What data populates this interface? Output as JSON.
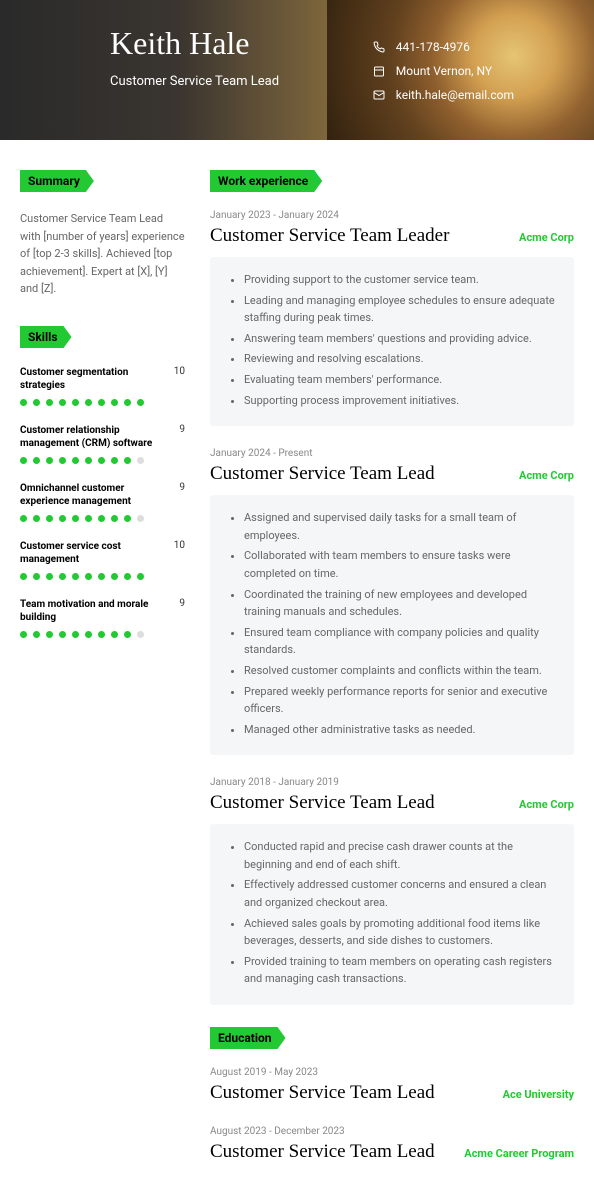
{
  "header": {
    "name": "Keith Hale",
    "title": "Customer Service Team Lead",
    "phone": "441-178-4976",
    "location": "Mount Vernon, NY",
    "email": "keith.hale@email.com"
  },
  "sections": {
    "summary": "Summary",
    "skills": "Skills",
    "work": "Work experience",
    "education": "Education"
  },
  "summary_text": "Customer Service Team Lead with [number of years] experience of [top 2-3 skills]. Achieved [top achievement]. Expert at [X], [Y] and [Z].",
  "skills": [
    {
      "name": "Customer segmentation strategies",
      "level": 10
    },
    {
      "name": "Customer relationship management (CRM) software",
      "level": 9
    },
    {
      "name": "Omnichannel customer experience management",
      "level": 9
    },
    {
      "name": "Customer service cost management",
      "level": 10
    },
    {
      "name": "Team motivation and morale building",
      "level": 9
    }
  ],
  "jobs": [
    {
      "dates": "January 2023 - January 2024",
      "title": "Customer Service Team Leader",
      "company": "Acme Corp",
      "bullets": [
        "Providing support to the customer service team.",
        "Leading and managing employee schedules to ensure adequate staffing during peak times.",
        "Answering team members' questions and providing advice.",
        "Reviewing and resolving escalations.",
        "Evaluating team members' performance.",
        "Supporting process improvement initiatives."
      ]
    },
    {
      "dates": "January 2024 - Present",
      "title": "Customer Service Team Lead",
      "company": "Acme Corp",
      "bullets": [
        "Assigned and supervised daily tasks for a small team of employees.",
        "Collaborated with team members to ensure tasks were completed on time.",
        "Coordinated the training of new employees and developed training manuals and schedules.",
        "Ensured team compliance with company policies and quality standards.",
        "Resolved customer complaints and conflicts within the team.",
        "Prepared weekly performance reports for senior and executive officers.",
        "Managed other administrative tasks as needed."
      ]
    },
    {
      "dates": "January 2018 - January 2019",
      "title": "Customer Service Team Lead",
      "company": "Acme Corp",
      "bullets": [
        "Conducted rapid and precise cash drawer counts at the beginning and end of each shift.",
        "Effectively addressed customer concerns and ensured a clean and organized checkout area.",
        "Achieved sales goals by promoting additional food items like beverages, desserts, and side dishes to customers.",
        "Provided training to team members on operating cash registers and managing cash transactions."
      ]
    }
  ],
  "education": [
    {
      "dates": "August 2019 - May 2023",
      "title": "Customer Service Team Lead",
      "company": "Ace University"
    },
    {
      "dates": "August 2023 - December 2023",
      "title": "Customer Service Team Lead",
      "company": "Acme Career Program"
    }
  ]
}
